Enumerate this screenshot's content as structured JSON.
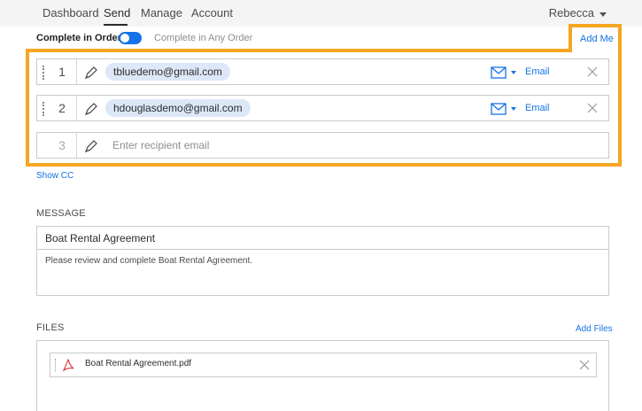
{
  "nav": {
    "tabs": [
      "Dashboard",
      "Send",
      "Manage",
      "Account"
    ],
    "active": "Send",
    "user": "Rebecca"
  },
  "order": {
    "complete_in_order": "Complete in Order",
    "complete_any_order": "Complete in Any Order",
    "toggle_on": true
  },
  "add_me": "Add Me",
  "recipients": [
    {
      "number": "1",
      "email": "tbluedemo@gmail.com",
      "method": "Email"
    },
    {
      "number": "2",
      "email": "hdouglasdemo@gmail.com",
      "method": "Email"
    },
    {
      "number": "3",
      "placeholder": "Enter recipient email"
    }
  ],
  "show_cc": "Show CC",
  "message": {
    "label": "MESSAGE",
    "subject": "Boat Rental Agreement",
    "body": "Please review and complete Boat Rental Agreement."
  },
  "files": {
    "label": "FILES",
    "add_files": "Add Files",
    "items": [
      {
        "name": "Boat Rental Agreement.pdf"
      }
    ]
  },
  "colors": {
    "accent": "#1473e6",
    "highlight": "#f5a623",
    "chip": "#dce8f7"
  },
  "icons": {
    "pen": "pen-icon",
    "mail": "mail-icon",
    "close": "close-icon",
    "pdf": "pdf-icon"
  }
}
